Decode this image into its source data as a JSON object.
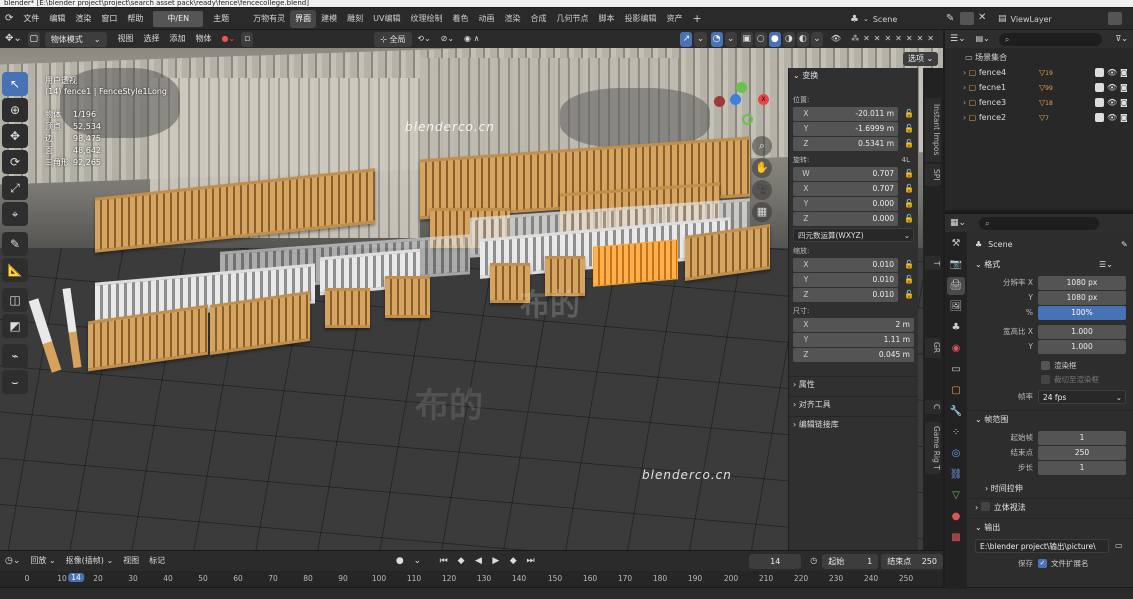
{
  "titlebar": {
    "text": "blender* [E:\\blender project\\project\\search asset pack\\ready\\fence\\fencecollege.blend]"
  },
  "menu": [
    "文件",
    "编辑",
    "渲染",
    "窗口",
    "帮助"
  ],
  "ime": "中/EN",
  "menu_extra": "主题",
  "workspaces": [
    {
      "label": "万物有灵",
      "active": false
    },
    {
      "label": "界面",
      "active": true
    },
    {
      "label": "建模",
      "active": false
    },
    {
      "label": "雕刻",
      "active": false
    },
    {
      "label": "UV编辑",
      "active": false
    },
    {
      "label": "纹理绘制",
      "active": false
    },
    {
      "label": "着色",
      "active": false
    },
    {
      "label": "动画",
      "active": false
    },
    {
      "label": "渲染",
      "active": false
    },
    {
      "label": "合成",
      "active": false
    },
    {
      "label": "几何节点",
      "active": false
    },
    {
      "label": "脚本",
      "active": false
    },
    {
      "label": "投影编辑",
      "active": false
    },
    {
      "label": "资产",
      "active": false
    }
  ],
  "scene": {
    "label": "Scene"
  },
  "view_layer": {
    "label": "ViewLayer"
  },
  "viewport_header": {
    "mode": "物体模式",
    "items": [
      "视图",
      "选择",
      "添加",
      "物体"
    ],
    "transform_space": "全局",
    "options_label": "选项"
  },
  "viewport": {
    "view_name": "用户透视",
    "object_info": "(14) fence1 | FenceStyle1Long",
    "stats": [
      {
        "label": "物体",
        "value": "1/196"
      },
      {
        "label": "顶点",
        "value": "52,534"
      },
      {
        "label": "边",
        "value": "98,475"
      },
      {
        "label": "面",
        "value": "48,642"
      },
      {
        "label": "三角形",
        "value": "92,265"
      }
    ],
    "watermark": "blenderco.cn",
    "watermark2": "布的",
    "watermark3": "blenderco.cn"
  },
  "npanel": {
    "transform_title": "变换",
    "location_label": "位置:",
    "location": [
      {
        "k": "X",
        "v": "-20.011 m"
      },
      {
        "k": "Y",
        "v": "-1.6999 m"
      },
      {
        "k": "Z",
        "v": "0.5341 m"
      }
    ],
    "rotation_label": "旋转:",
    "rotation_mode_tag": "4L",
    "rotation": [
      {
        "k": "W",
        "v": "0.707"
      },
      {
        "k": "X",
        "v": "0.707"
      },
      {
        "k": "Y",
        "v": "0.000"
      },
      {
        "k": "Z",
        "v": "0.000"
      }
    ],
    "rotation_mode": "四元数运算(WXYZ)",
    "scale_label": "缩放:",
    "scale": [
      {
        "k": "X",
        "v": "0.010"
      },
      {
        "k": "Y",
        "v": "0.010"
      },
      {
        "k": "Z",
        "v": "0.010"
      }
    ],
    "dimensions_label": "尺寸:",
    "dimensions": [
      {
        "k": "X",
        "v": "2 m"
      },
      {
        "k": "Y",
        "v": "1.11 m"
      },
      {
        "k": "Z",
        "v": "0.045 m"
      }
    ],
    "sections": [
      "属性",
      "对齐工具",
      "编辑链接库"
    ]
  },
  "vtabs": [
    "Instant Impos",
    "SPI",
    "T",
    "GR",
    "C",
    "Game Rig T"
  ],
  "timeline": {
    "menu": [
      "回放",
      "抠像(插帧)",
      "视图",
      "标记"
    ],
    "current_frame": "14",
    "start_label": "起始",
    "start": "1",
    "end_label": "结束点",
    "end": "250",
    "ticks": [
      "0",
      "10",
      "14",
      "20",
      "30",
      "40",
      "50",
      "60",
      "70",
      "80",
      "90",
      "100",
      "110",
      "120",
      "130",
      "140",
      "150",
      "160",
      "170",
      "180",
      "190",
      "200",
      "210",
      "220",
      "230",
      "240",
      "250"
    ]
  },
  "outliner": {
    "root": "场景集合",
    "items": [
      {
        "name": "fence4",
        "count": "19"
      },
      {
        "name": "fecne1",
        "count": "99"
      },
      {
        "name": "fence3",
        "count": "18"
      },
      {
        "name": "fence2",
        "count": "7"
      }
    ]
  },
  "properties": {
    "scene_name": "Scene",
    "format_title": "格式",
    "res_x_label": "分辨率 X",
    "res_x": "1080 px",
    "res_y_label": "Y",
    "res_y": "1080 px",
    "percent_label": "%",
    "percent": "100%",
    "aspect_x_label": "宽高比 X",
    "aspect_x": "1.000",
    "aspect_y_label": "Y",
    "aspect_y": "1.000",
    "border_label": "渲染框",
    "crop_label": "裁切至渲染框",
    "fps_label": "帧率",
    "fps": "24 fps",
    "frame_range_title": "帧范围",
    "frame_start_label": "起始帧",
    "frame_start": "1",
    "frame_end_label": "结束点",
    "frame_end": "250",
    "step_label": "步长",
    "step": "1",
    "time_stretch": "时间拉伸",
    "stereo": "立体视法",
    "output_title": "输出",
    "output_path": "E:\\blender project\\输出\\picture\\",
    "save_label": "保存",
    "file_ext_label": "文件扩展名"
  },
  "colors": {
    "accent": "#4772b3",
    "bg": "#1d1d1d",
    "panel": "#303030"
  }
}
